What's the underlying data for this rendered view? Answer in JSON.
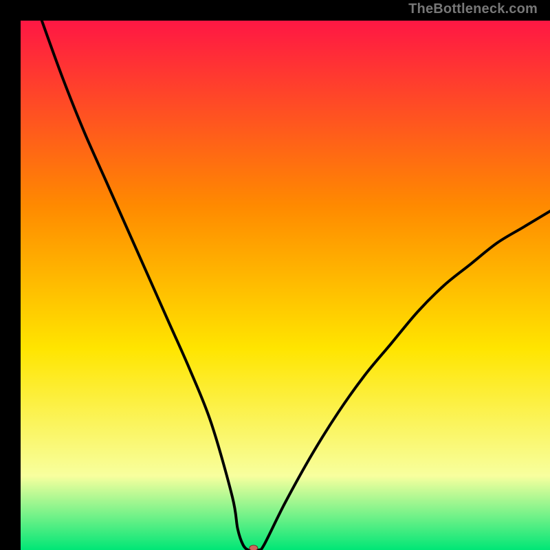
{
  "watermark": "TheBottleneck.com",
  "chart_data": {
    "type": "line",
    "title": "",
    "xlabel": "",
    "ylabel": "",
    "xlim": [
      0,
      100
    ],
    "ylim": [
      0,
      100
    ],
    "background_gradient": {
      "top": "#ff1744",
      "mid_upper": "#ff8a00",
      "mid": "#ffe500",
      "lower": "#f8ff9e",
      "bottom": "#00e676"
    },
    "series": [
      {
        "name": "bottleneck-curve",
        "color": "#000000",
        "x": [
          4,
          8,
          12,
          16,
          20,
          24,
          28,
          32,
          36,
          40,
          41,
          42,
          43,
          44,
          45,
          46,
          50,
          55,
          60,
          65,
          70,
          75,
          80,
          85,
          90,
          95,
          100
        ],
        "values": [
          100,
          89,
          79,
          70,
          61,
          52,
          43,
          34,
          24,
          10,
          4,
          1,
          0,
          0,
          0,
          1,
          9,
          18,
          26,
          33,
          39,
          45,
          50,
          54,
          58,
          61,
          64
        ]
      }
    ],
    "marker": {
      "name": "optimal-point",
      "x": 44,
      "y": 0,
      "color": "#d0635c",
      "rx": 6,
      "ry": 4
    }
  }
}
